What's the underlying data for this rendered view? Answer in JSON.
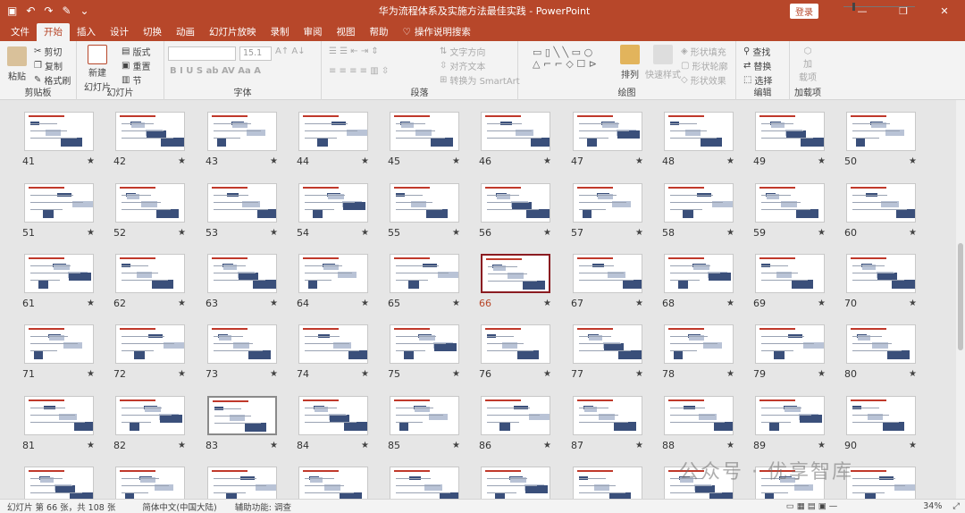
{
  "titlebar": {
    "title": "华为流程体系及实施方法最佳实践 - PowerPoint",
    "login": "登录",
    "minimize": "—",
    "restore": "❐",
    "close": "✕"
  },
  "tabs": [
    "文件",
    "开始",
    "插入",
    "设计",
    "切换",
    "动画",
    "幻灯片放映",
    "录制",
    "审阅",
    "视图",
    "帮助"
  ],
  "tell_me": "操作说明搜索",
  "ribbon": {
    "clipboard": {
      "paste": "粘贴",
      "cut": "剪切",
      "copy": "复制",
      "format_painter": "格式刷",
      "label": "剪贴板"
    },
    "slides": {
      "new": "新建",
      "new2": "幻灯片",
      "layout": "版式",
      "reset": "重置",
      "section": "节",
      "label": "幻灯片"
    },
    "font": {
      "size": "15.1",
      "label": "字体"
    },
    "paragraph": {
      "text_direction": "文字方向",
      "align_text": "对齐文本",
      "smartart": "转换为 SmartArt",
      "label": "段落"
    },
    "drawing": {
      "arrange": "排列",
      "quick_styles": "快速样式",
      "fill": "形状填充",
      "outline": "形状轮廓",
      "effects": "形状效果",
      "label": "绘图"
    },
    "editing": {
      "find": "查找",
      "replace": "替换",
      "select": "选择",
      "label": "编辑"
    },
    "addins": {
      "addin": "加",
      "addin2": "载项",
      "label": "加载项"
    }
  },
  "slides": [
    {
      "n": "41"
    },
    {
      "n": "42"
    },
    {
      "n": "43"
    },
    {
      "n": "44"
    },
    {
      "n": "45"
    },
    {
      "n": "46"
    },
    {
      "n": "47"
    },
    {
      "n": "48"
    },
    {
      "n": "49"
    },
    {
      "n": "50"
    },
    {
      "n": "51"
    },
    {
      "n": "52"
    },
    {
      "n": "53"
    },
    {
      "n": "54"
    },
    {
      "n": "55"
    },
    {
      "n": "56"
    },
    {
      "n": "57"
    },
    {
      "n": "58"
    },
    {
      "n": "59"
    },
    {
      "n": "60"
    },
    {
      "n": "61"
    },
    {
      "n": "62"
    },
    {
      "n": "63"
    },
    {
      "n": "64"
    },
    {
      "n": "65"
    },
    {
      "n": "66"
    },
    {
      "n": "67"
    },
    {
      "n": "68"
    },
    {
      "n": "69"
    },
    {
      "n": "70"
    },
    {
      "n": "71"
    },
    {
      "n": "72"
    },
    {
      "n": "73"
    },
    {
      "n": "74"
    },
    {
      "n": "75"
    },
    {
      "n": "76"
    },
    {
      "n": "77"
    },
    {
      "n": "78"
    },
    {
      "n": "79"
    },
    {
      "n": "80"
    },
    {
      "n": "81"
    },
    {
      "n": "82"
    },
    {
      "n": "83"
    },
    {
      "n": "84"
    },
    {
      "n": "85"
    },
    {
      "n": "86"
    },
    {
      "n": "87"
    },
    {
      "n": "88"
    },
    {
      "n": "89"
    },
    {
      "n": "90"
    },
    {
      "n": ""
    },
    {
      "n": ""
    },
    {
      "n": ""
    },
    {
      "n": ""
    },
    {
      "n": ""
    },
    {
      "n": ""
    },
    {
      "n": ""
    },
    {
      "n": ""
    },
    {
      "n": ""
    },
    {
      "n": ""
    }
  ],
  "selected_slide": "66",
  "star": "★",
  "watermark": "公众号 · 优享智库",
  "status": {
    "slide_count": "幻灯片 第 66 张，共 108 张",
    "language": "简体中文(中国大陆)",
    "accessibility": "辅助功能: 调查",
    "zoom": "34%"
  },
  "colors": {
    "accent": "#b7472a",
    "selected_border": "#8b1c21"
  }
}
